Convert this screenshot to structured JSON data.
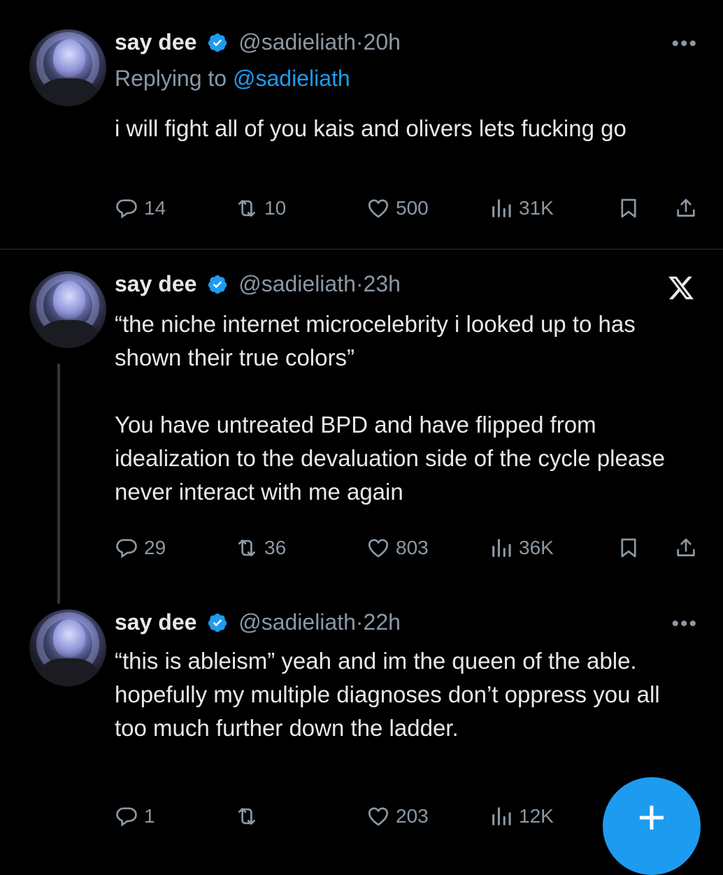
{
  "tweets": [
    {
      "name": "say dee",
      "handle": "@sadieliath",
      "time": "·20h",
      "replying_prefix": "Replying to ",
      "replying_to": "@sadieliath",
      "text": "i will fight all of you kais and olivers lets fucking go",
      "replies": "14",
      "reposts": "10",
      "likes": "500",
      "views": "31K",
      "corner_icon": "more-dots-icon",
      "corner_text": "•••"
    },
    {
      "name": "say dee",
      "handle": "@sadieliath",
      "time": "·23h",
      "text": "“the niche internet microcelebrity i looked up to has shown their true colors”\n\nYou have untreated BPD and have flipped from idealization to the devaluation side of the cycle please never interact with me again",
      "replies": "29",
      "reposts": "36",
      "likes": "803",
      "views": "36K",
      "corner_icon": "x-logo-icon"
    },
    {
      "name": "say dee",
      "handle": "@sadieliath",
      "time": "·22h",
      "text": "“this is ableism” yeah and im the queen of the able. hopefully my multiple diagnoses don’t oppress you all too much further down the ladder.",
      "replies": "1",
      "reposts": "",
      "likes": "203",
      "views": "12K",
      "corner_icon": "more-dots-icon",
      "corner_text": "•••"
    }
  ],
  "fab": {
    "label": "+"
  },
  "colors": {
    "background": "#000000",
    "text": "#e7e9ea",
    "secondary": "#8b98a5",
    "accent": "#1d9bf0",
    "divider": "#2f3336"
  }
}
